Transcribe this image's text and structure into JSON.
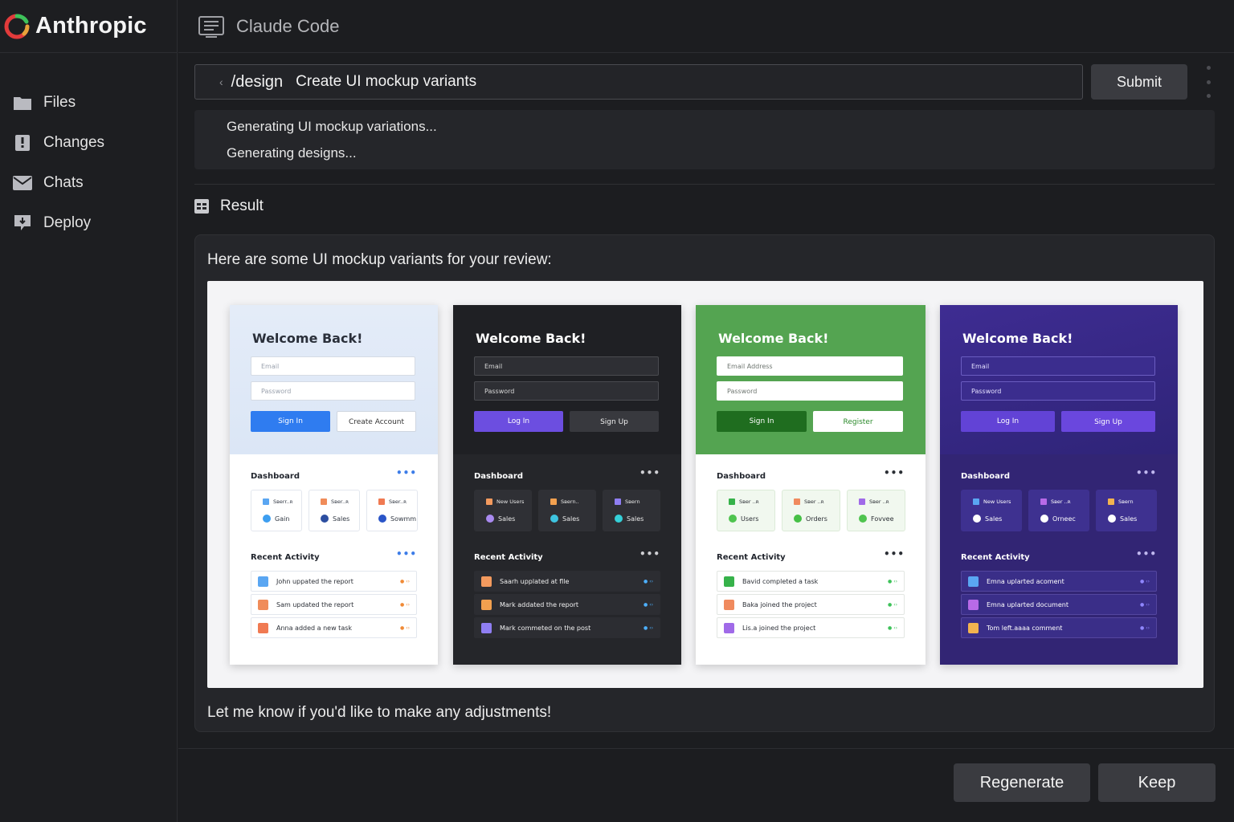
{
  "brand": {
    "name": "Anthropic",
    "icon": "anthropic-logo"
  },
  "header": {
    "title": "Claude Code",
    "icon": "terminal-window-icon"
  },
  "sidebar": {
    "items": [
      {
        "label": "Files",
        "icon": "folder-icon"
      },
      {
        "label": "Changes",
        "icon": "changes-icon"
      },
      {
        "label": "Chats",
        "icon": "mail-icon"
      },
      {
        "label": "Deploy",
        "icon": "deploy-icon"
      }
    ]
  },
  "command": {
    "caret": "‹",
    "command": "/design",
    "text": "Create UI mockup variants",
    "submit_label": "Submit"
  },
  "status": {
    "lines": [
      "Generating UI mockup variations...",
      "Generating designs..."
    ]
  },
  "result": {
    "title": "Result",
    "intro": "Here are some UI mockup variants for your review:",
    "outro": "Let me know if you'd like to make any adjustments!"
  },
  "mockups": [
    {
      "theme": "light-blue",
      "welcome": "Welcome Back!",
      "input1": "Email",
      "input2": "Password",
      "btn_primary": "Sign In",
      "btn_secondary": "Create Account",
      "dashboard": "Dashboard",
      "recent": "Recent Activity",
      "stats": [
        {
          "top": "Sʙerr..ʀ",
          "bottom": "Gain"
        },
        {
          "top": "Sʙer..ʀ",
          "bottom": "Sales"
        },
        {
          "top": "Sʙer..ʀ",
          "bottom": "Sowmm"
        }
      ],
      "activity": [
        "John uppated the report",
        "Sam updated the report",
        "Anna added a new task"
      ]
    },
    {
      "theme": "dark",
      "welcome": "Welcome Back!",
      "input1": "Email",
      "input2": "Password",
      "btn_primary": "Log In",
      "btn_secondary": "Sign Up",
      "dashboard": "Dashboard",
      "recent": "Recent Activity",
      "stats": [
        {
          "top": "New Users",
          "bottom": "Sales"
        },
        {
          "top": "Sʙern..",
          "bottom": "Sales"
        },
        {
          "top": "Sʙern",
          "bottom": "Sales"
        }
      ],
      "activity": [
        "Saarh upplated at flle",
        "Mark addated the report",
        "Mark commeted on the post"
      ]
    },
    {
      "theme": "green",
      "welcome": "Welcome Back!",
      "input1": "Email Address",
      "input2": "Password",
      "btn_primary": "Sign In",
      "btn_secondary": "Register",
      "dashboard": "Dashboard",
      "recent": "Recent Activity",
      "stats": [
        {
          "top": "Sʙer ..ʀ",
          "bottom": "Users"
        },
        {
          "top": "Sʙer ..ʀ",
          "bottom": "Orders"
        },
        {
          "top": "Sʙer ..ʀ",
          "bottom": "Fovvee"
        }
      ],
      "activity": [
        "Bavid completed a task",
        "Baka joined the project",
        "Lis.a joined the project"
      ]
    },
    {
      "theme": "purple",
      "welcome": "Welcome Back!",
      "input1": "Email",
      "input2": "Password",
      "btn_primary": "Log In",
      "btn_secondary": "Sign Up",
      "dashboard": "Dashboard",
      "recent": "Recent Activity",
      "stats": [
        {
          "top": "New Users",
          "bottom": "Sales"
        },
        {
          "top": "Sʙer ..ʀ",
          "bottom": "Orneec"
        },
        {
          "top": "Sʙern",
          "bottom": "Sales"
        }
      ],
      "activity": [
        "Emna uplarted acoment",
        "Emna uplarted document",
        "Tom left.aaaa comment"
      ]
    }
  ],
  "actions": {
    "regenerate": "Regenerate",
    "keep": "Keep"
  }
}
